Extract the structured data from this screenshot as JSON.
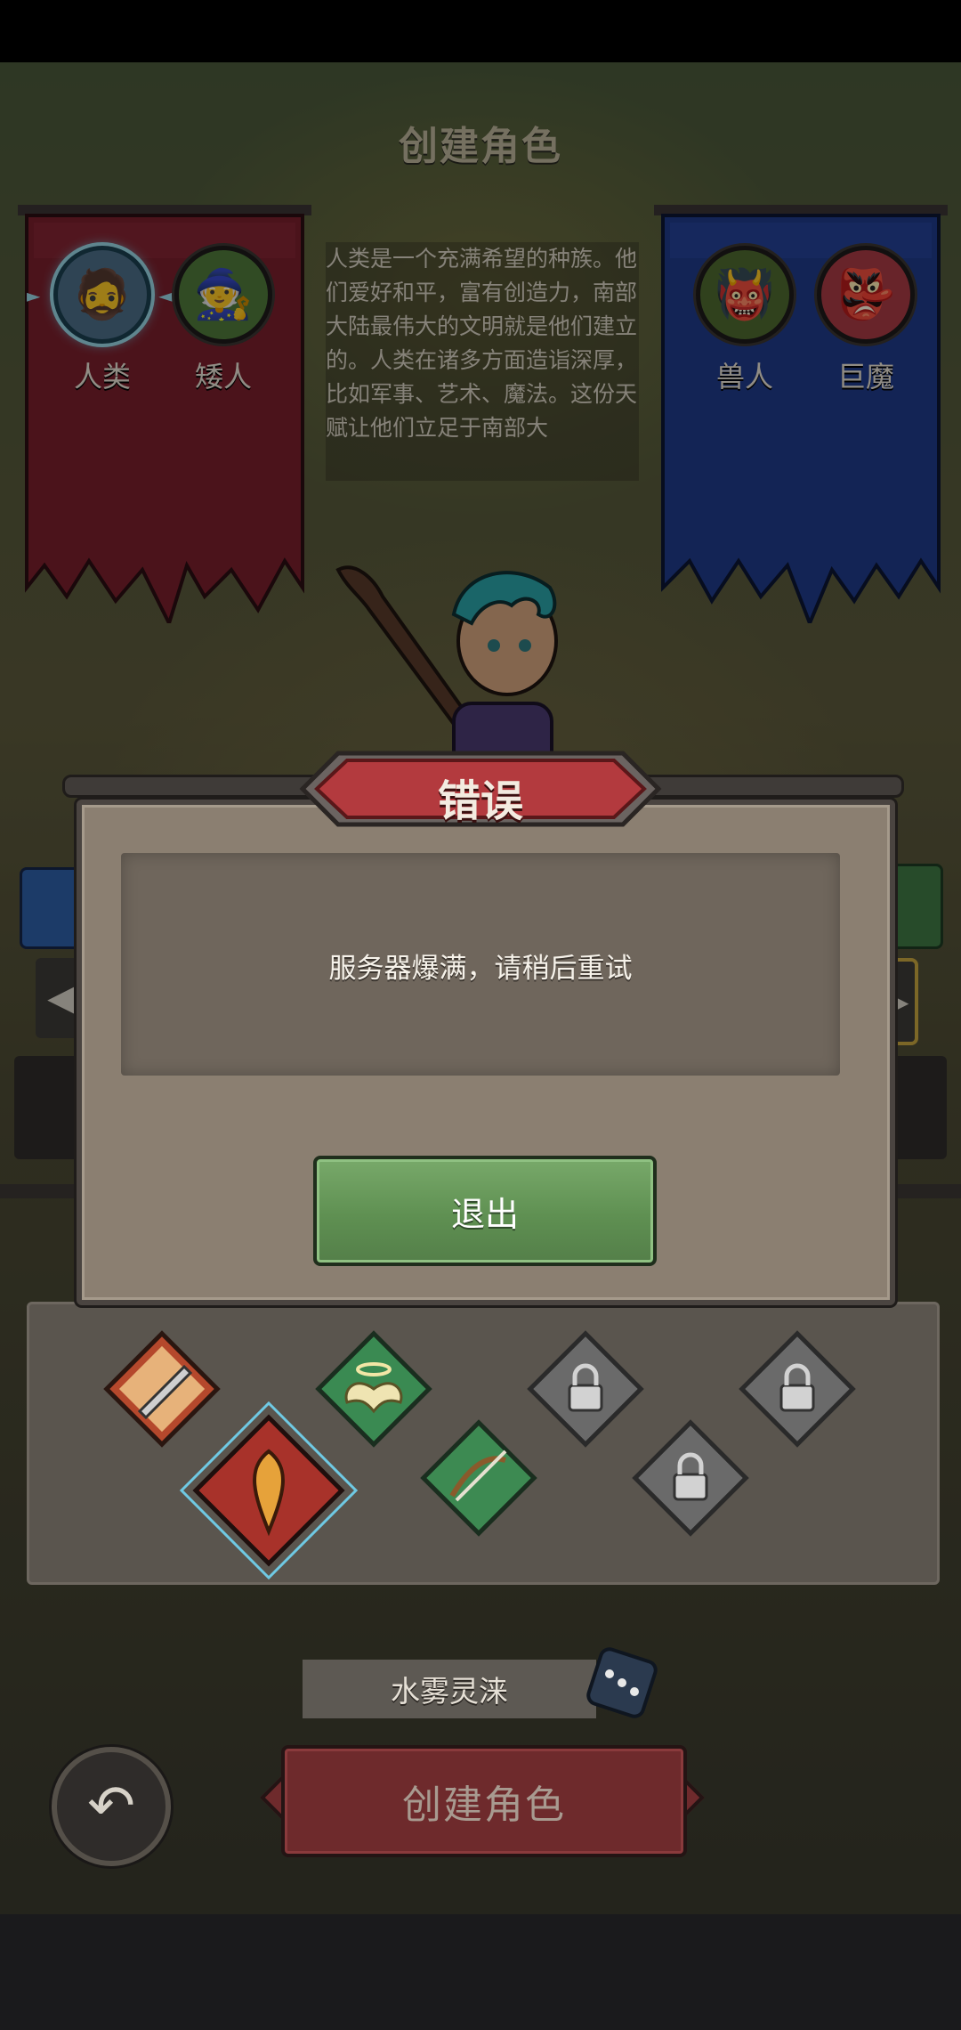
{
  "header": {
    "title": "创建角色"
  },
  "races": {
    "alliance": [
      {
        "label": "人类",
        "icon": "human-portrait-icon",
        "selected": true
      },
      {
        "label": "矮人",
        "icon": "dwarf-portrait-icon",
        "selected": false
      }
    ],
    "horde": [
      {
        "label": "兽人",
        "icon": "orc-portrait-icon",
        "selected": false
      },
      {
        "label": "巨魔",
        "icon": "troll-portrait-icon",
        "selected": false
      }
    ],
    "description": "人类是一个充满希望的种族。他们爱好和平，富有创造力，南部大陆最伟大的文明就是他们建立的。人类在诸多方面造诣深厚，比如军事、艺术、魔法。这份天赋让他们立足于南部大"
  },
  "dialog": {
    "title": "错误",
    "message": "服务器爆满，请稍后重试",
    "exit_label": "退出"
  },
  "classes": [
    {
      "icon": "warrior-sword-icon",
      "locked": false,
      "selected": false
    },
    {
      "icon": "priest-wings-icon",
      "locked": false,
      "selected": false
    },
    {
      "icon": "locked-class-icon",
      "locked": true,
      "selected": false
    },
    {
      "icon": "locked-class-icon",
      "locked": true,
      "selected": false
    },
    {
      "icon": "mage-flame-icon",
      "locked": false,
      "selected": true
    },
    {
      "icon": "hunter-bow-icon",
      "locked": false,
      "selected": false
    },
    {
      "icon": "locked-class-icon",
      "locked": true,
      "selected": false
    }
  ],
  "character": {
    "name": "水雾灵涞"
  },
  "footer": {
    "create_label": "创建角色"
  },
  "colors": {
    "alliance_banner": "#7a1f2c",
    "horde_banner": "#1f3a8a",
    "dialog_bg": "#8b7f71",
    "exit_button": "#5f9052",
    "create_button": "#6e2a2c"
  }
}
